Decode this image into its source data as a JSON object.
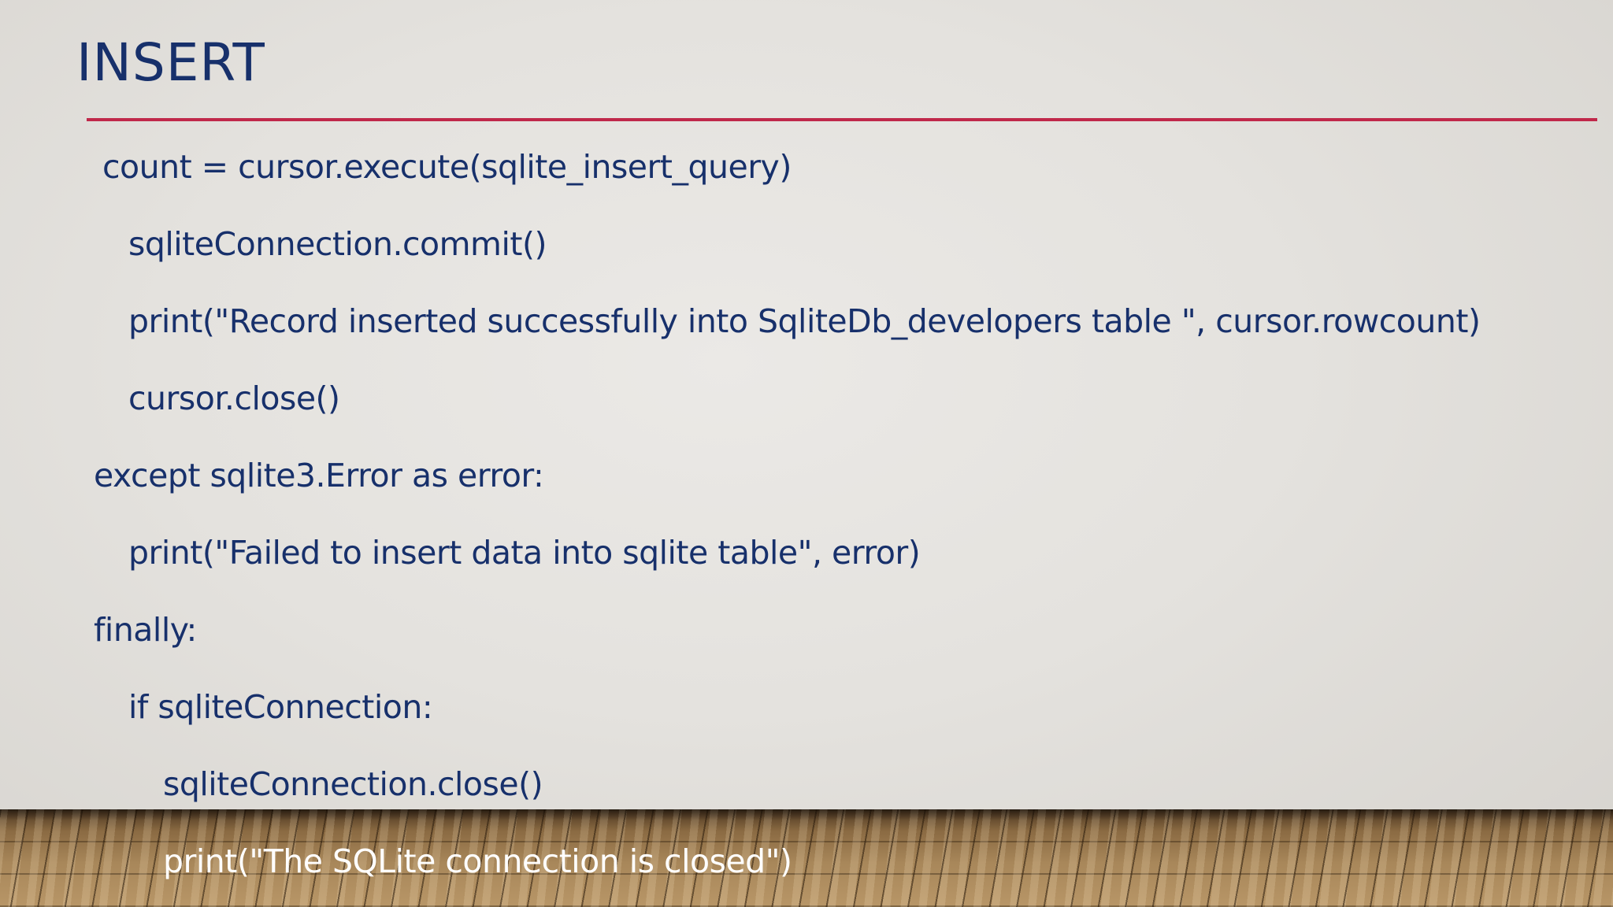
{
  "slide": {
    "title": "INSERT",
    "code_lines": [
      "count = cursor.execute(sqlite_insert_query)",
      "sqliteConnection.commit()",
      "print(\"Record inserted successfully into SqliteDb_developers table \", cursor.rowcount)",
      "cursor.close()",
      "except sqlite3.Error as error:",
      "print(\"Failed to insert data into sqlite table\", error)",
      "finally:",
      "if sqliteConnection:",
      "sqliteConnection.close()",
      "print(\"The SQLite connection is closed\")"
    ]
  },
  "colors": {
    "title_text": "#17306b",
    "accent_rule": "#c0284a",
    "body_text": "#17306b",
    "floor_text": "#ffffff"
  }
}
